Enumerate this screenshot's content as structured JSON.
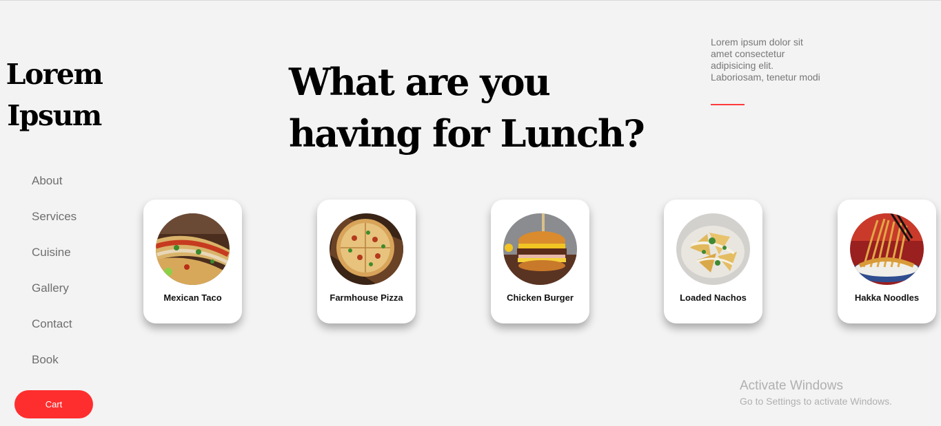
{
  "brand": {
    "line1": "Lorem",
    "line2": "Ipsum"
  },
  "nav": [
    {
      "label": "About"
    },
    {
      "label": "Services"
    },
    {
      "label": "Cuisine"
    },
    {
      "label": "Gallery"
    },
    {
      "label": "Contact"
    },
    {
      "label": "Book"
    }
  ],
  "cart_label": "Cart",
  "headline": {
    "line1": "What are you",
    "line2": "having for Lunch?"
  },
  "aside": {
    "text": "Lorem ipsum dolor sit amet consectetur adipisicing elit. Laboriosam, tenetur modi"
  },
  "dishes": [
    {
      "name": "Mexican Taco",
      "icon": "taco-photo"
    },
    {
      "name": "Farmhouse Pizza",
      "icon": "pizza-photo"
    },
    {
      "name": "Chicken Burger",
      "icon": "burger-photo"
    },
    {
      "name": "Loaded Nachos",
      "icon": "nachos-photo"
    },
    {
      "name": "Hakka Noodles",
      "icon": "noodles-photo"
    }
  ],
  "watermark": {
    "title": "Activate Windows",
    "subtitle": "Go to Settings to activate Windows."
  },
  "colors": {
    "accent": "#ff2e2e",
    "background": "#f3f3f3",
    "card": "#ffffff"
  }
}
